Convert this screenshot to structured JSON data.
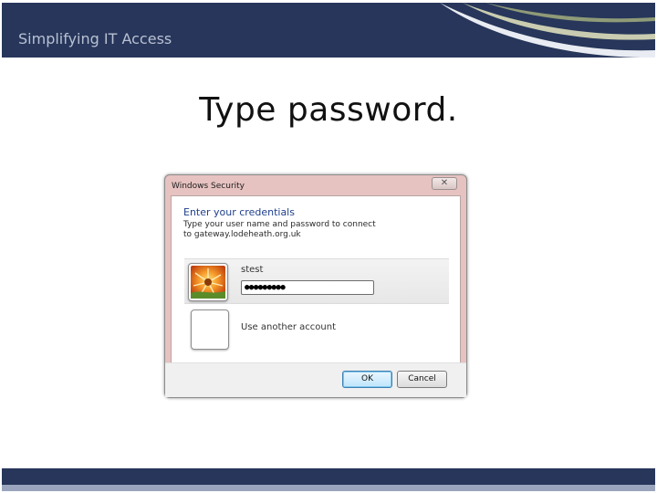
{
  "slide": {
    "header_title": "Simplifying IT Access",
    "title": "Type password."
  },
  "dialog": {
    "window_title": "Windows Security",
    "close_glyph": "✕",
    "heading": "Enter your credentials",
    "description": "Type your user name and password to connect to gateway.lodeheath.org.uk",
    "username": "stest",
    "password_value": "●●●●●●●●●",
    "other_account_label": "Use another account",
    "ok_label": "OK",
    "cancel_label": "Cancel"
  },
  "icons": {
    "user_picture": "flower-user-picture-icon",
    "blank_picture": "blank-user-picture-icon"
  },
  "colors": {
    "header_bg": "#27365a",
    "dialog_frame": "#e6c2c0",
    "heading_blue": "#1e3f8c"
  }
}
